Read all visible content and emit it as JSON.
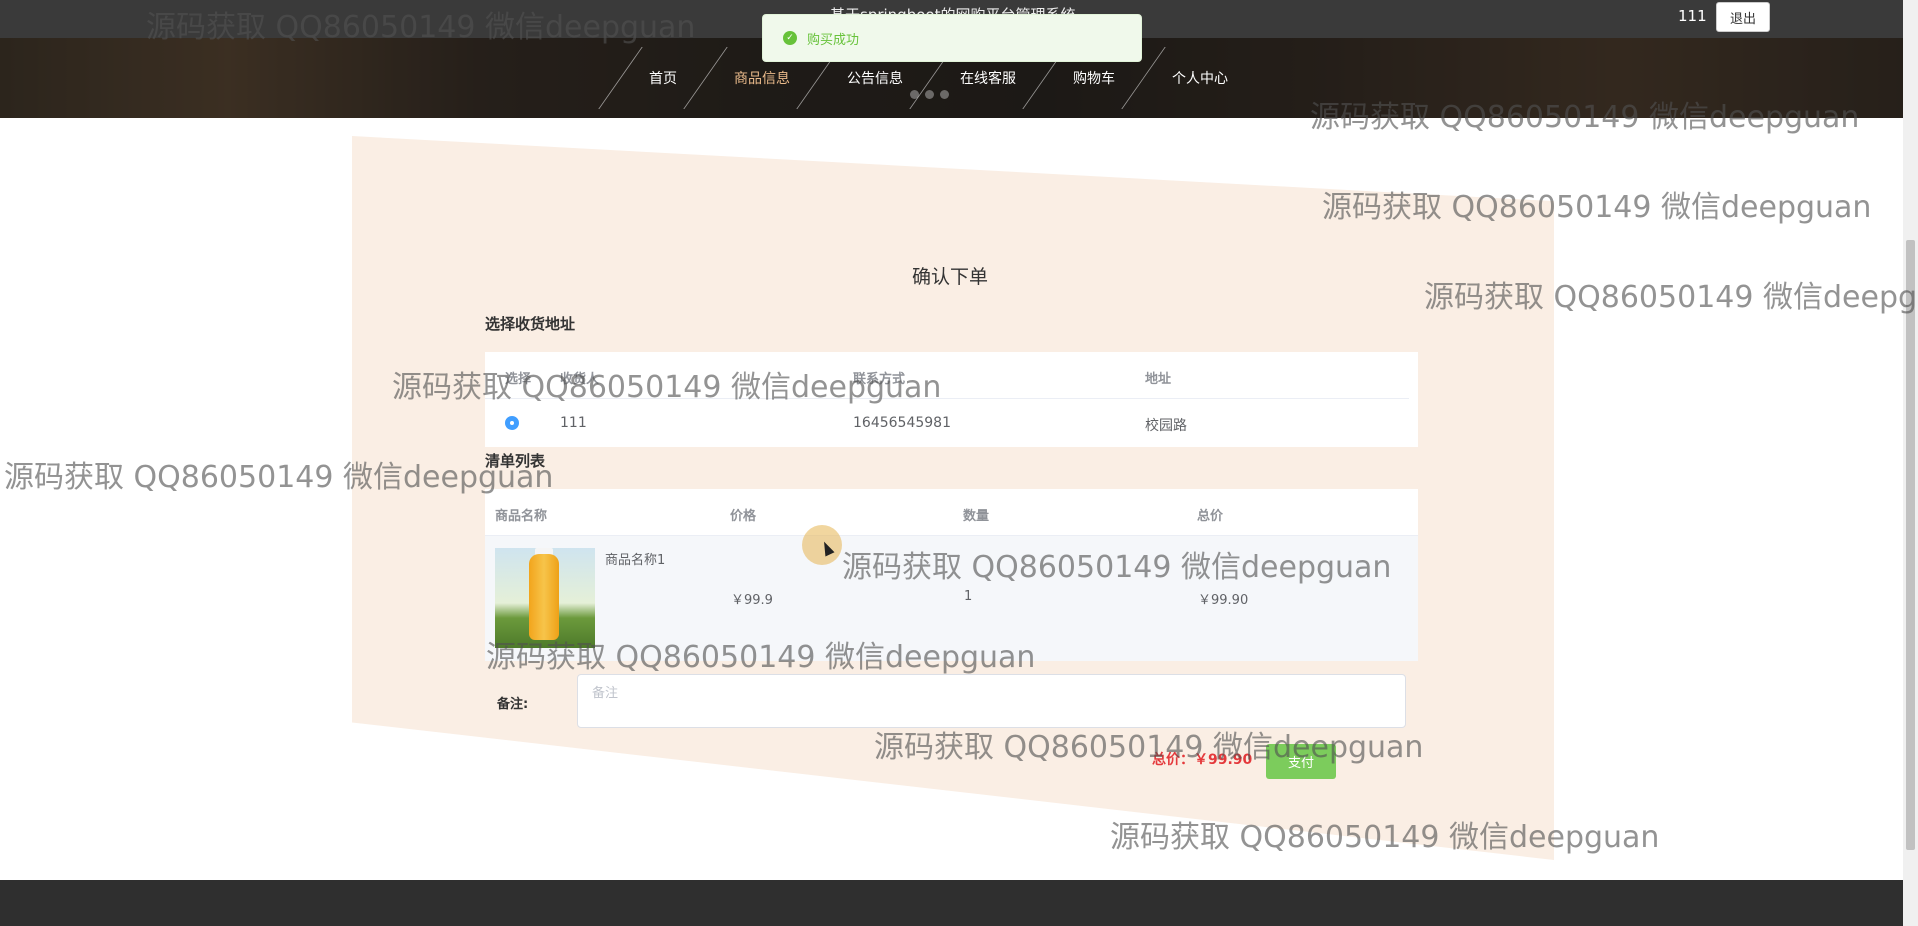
{
  "header": {
    "site_title": "基于springboot的网购平台管理系统",
    "user_name": "111",
    "logout_label": "退出"
  },
  "nav": {
    "items": [
      {
        "label": "首页",
        "active": false
      },
      {
        "label": "商品信息",
        "active": true
      },
      {
        "label": "公告信息",
        "active": false
      },
      {
        "label": "在线客服",
        "active": false
      },
      {
        "label": "购物车",
        "active": false
      },
      {
        "label": "个人中心",
        "active": false
      }
    ]
  },
  "toast": {
    "message": "购买成功",
    "icon": "check-circle-icon",
    "color": "#67c23a"
  },
  "page": {
    "heading": "确认下单",
    "address_section": "选择收货地址",
    "list_section": "清单列表"
  },
  "address_table": {
    "headers": [
      "选择",
      "收货人",
      "联系方式",
      "地址"
    ],
    "rows": [
      {
        "recipient": "111",
        "phone": "16456545981",
        "address": "校园路",
        "selected": true
      }
    ]
  },
  "goods_table": {
    "headers": [
      "商品名称",
      "价格",
      "数量",
      "总价"
    ],
    "rows": [
      {
        "name": "商品名称1",
        "price": "￥99.9",
        "quantity": "1",
        "total": "￥99.90"
      }
    ]
  },
  "order": {
    "note_label": "备注:",
    "note_placeholder": "备注",
    "total_label": "总价：￥99.90",
    "pay_label": "支付"
  },
  "watermark": "源码获取 QQ86050149 微信deepguan"
}
